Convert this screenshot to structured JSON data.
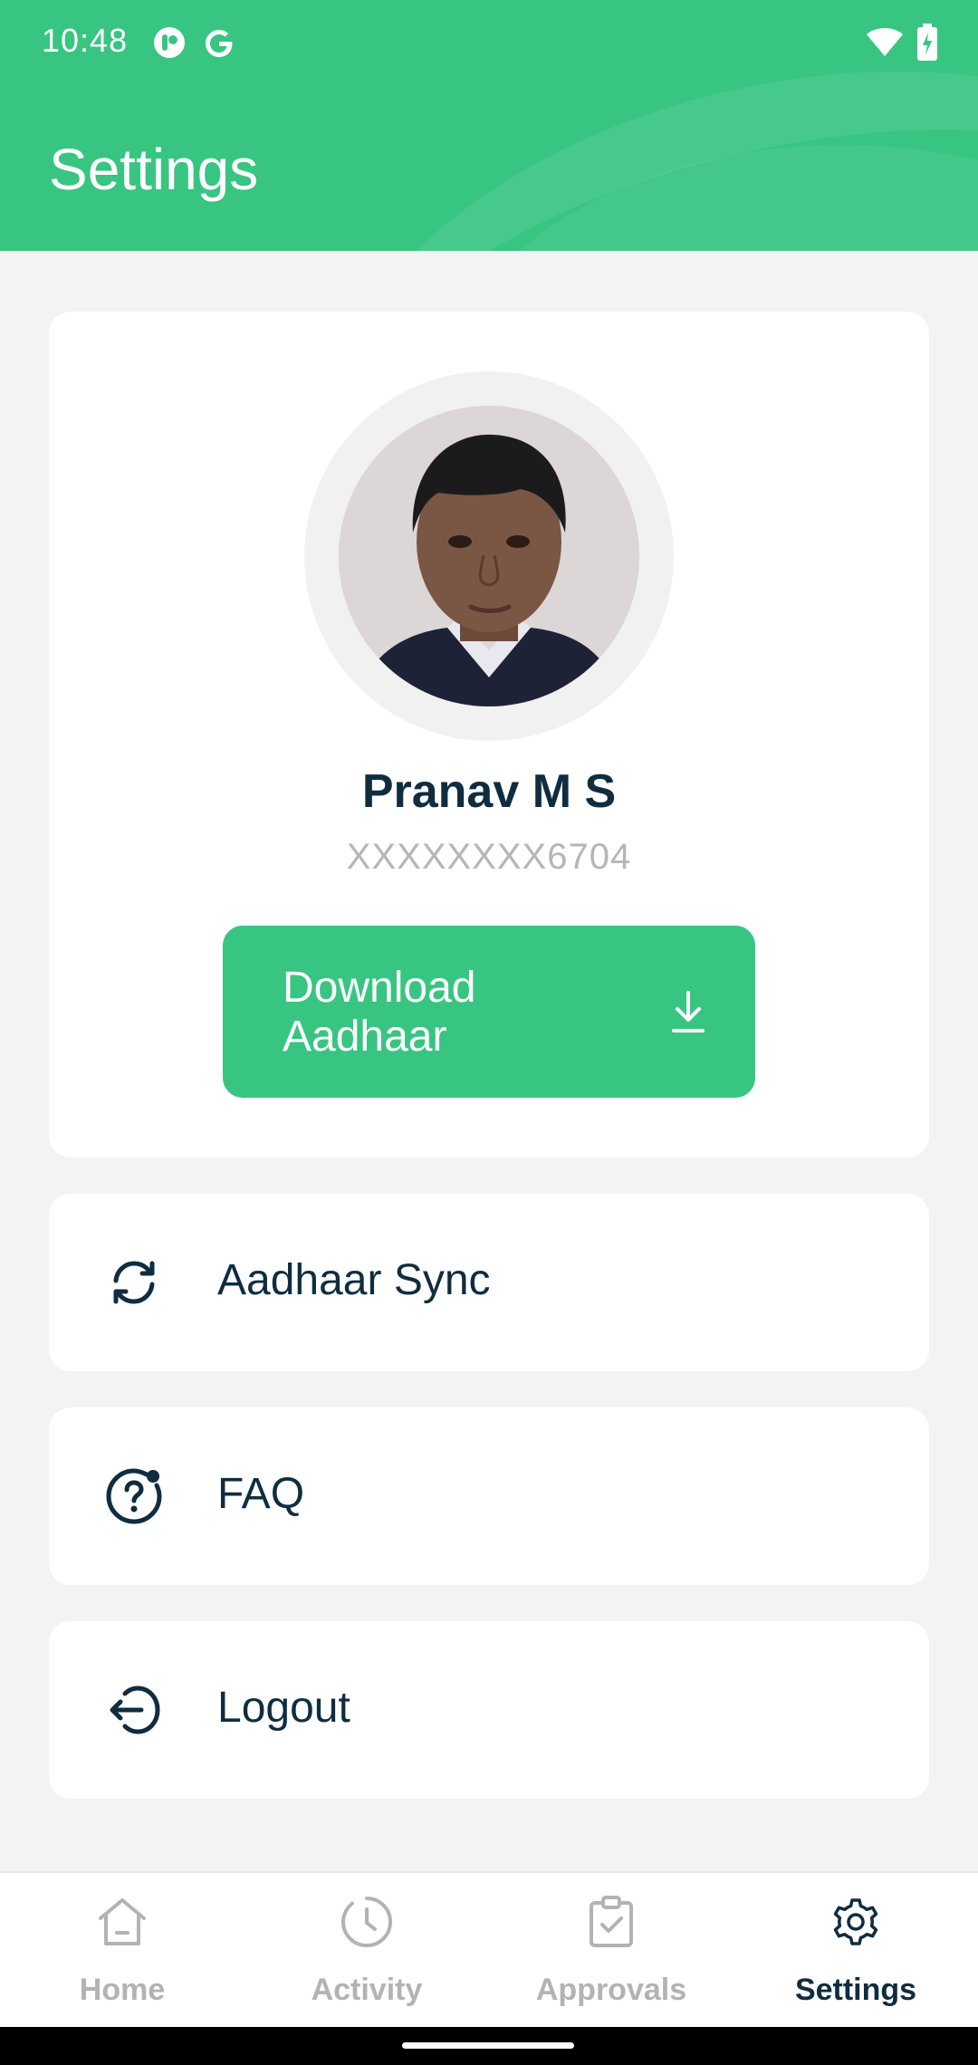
{
  "status_bar": {
    "time": "10:48"
  },
  "header": {
    "title": "Settings",
    "color": "#38c582"
  },
  "profile": {
    "name": "Pranav M S",
    "aadhaar_masked": "XXXXXXXX6704",
    "download_label": "Download Aadhaar"
  },
  "menu": {
    "sync_label": "Aadhaar Sync",
    "faq_label": "FAQ",
    "logout_label": "Logout"
  },
  "nav": {
    "items": [
      {
        "label": "Home",
        "icon": "home-icon",
        "active": false
      },
      {
        "label": "Activity",
        "icon": "clock-icon",
        "active": false
      },
      {
        "label": "Approvals",
        "icon": "clipboard-check-icon",
        "active": false
      },
      {
        "label": "Settings",
        "icon": "gear-icon",
        "active": true
      }
    ]
  },
  "colors": {
    "accent": "#38c582",
    "text_dark": "#0f2d3f",
    "text_muted": "#b3b3b3",
    "background": "#f3f3f3"
  }
}
